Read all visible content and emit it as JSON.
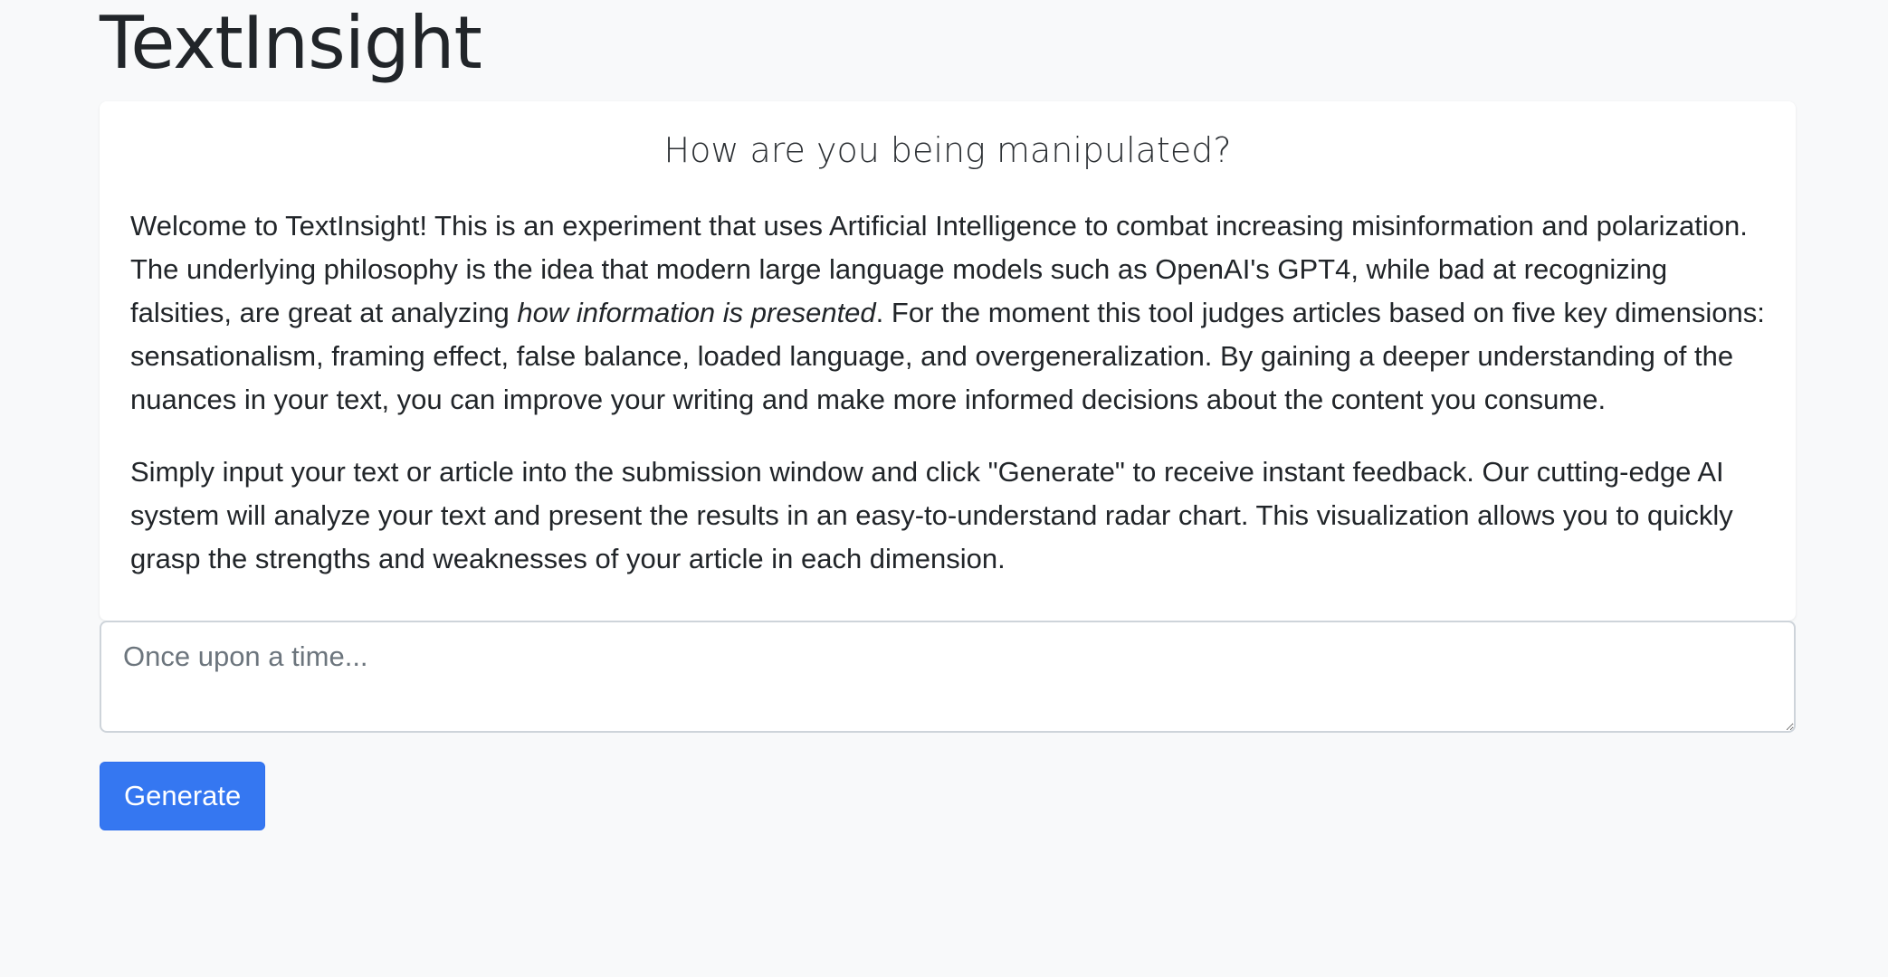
{
  "header": {
    "title": "TextInsight"
  },
  "intro_card": {
    "title": "How are you being manipulated?",
    "paragraph1_part1": "Welcome to TextInsight! This is an experiment that uses Artificial Intelligence to combat increasing misinformation and polarization. The underlying philosophy is the idea that modern large language models such as OpenAI's GPT4, while bad at recognizing falsities, are great at analyzing ",
    "paragraph1_emphasis": "how information is presented",
    "paragraph1_part2": ". For the moment this tool judges articles based on five key dimensions: sensationalism, framing effect, false balance, loaded language, and overgeneralization. By gaining a deeper understanding of the nuances in your text, you can improve your writing and make more informed decisions about the content you consume.",
    "paragraph2": "Simply input your text or article into the submission window and click \"Generate\" to receive instant feedback. Our cutting-edge AI system will analyze your text and present the results in an easy-to-understand radar chart. This visualization allows you to quickly grasp the strengths and weaknesses of your article in each dimension."
  },
  "input": {
    "value": "",
    "placeholder": "Once upon a time..."
  },
  "actions": {
    "generate_label": "Generate"
  },
  "colors": {
    "background": "#f8f9fa",
    "primary": "#3577f1",
    "text": "#212529",
    "placeholder": "#6c757d"
  }
}
